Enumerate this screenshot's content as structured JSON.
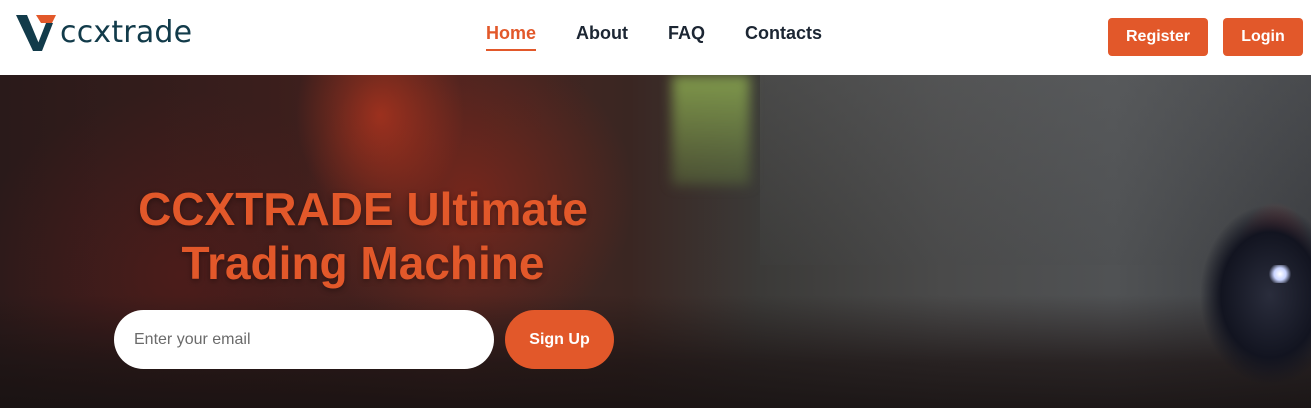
{
  "brand": {
    "name": "ccxtrade",
    "logo_icon": "v-logo-mark",
    "colors": {
      "accent": "#e2582a",
      "dark": "#123b4a"
    }
  },
  "nav": {
    "items": [
      {
        "label": "Home",
        "active": true
      },
      {
        "label": "About",
        "active": false
      },
      {
        "label": "FAQ",
        "active": false
      },
      {
        "label": "Contacts",
        "active": false
      }
    ]
  },
  "auth": {
    "register_label": "Register",
    "login_label": "Login"
  },
  "hero": {
    "title_line1": "CCXTRADE Ultimate",
    "title_line2": "Trading Machine",
    "email_placeholder": "Enter your email",
    "email_value": "",
    "signup_label": "Sign Up"
  }
}
